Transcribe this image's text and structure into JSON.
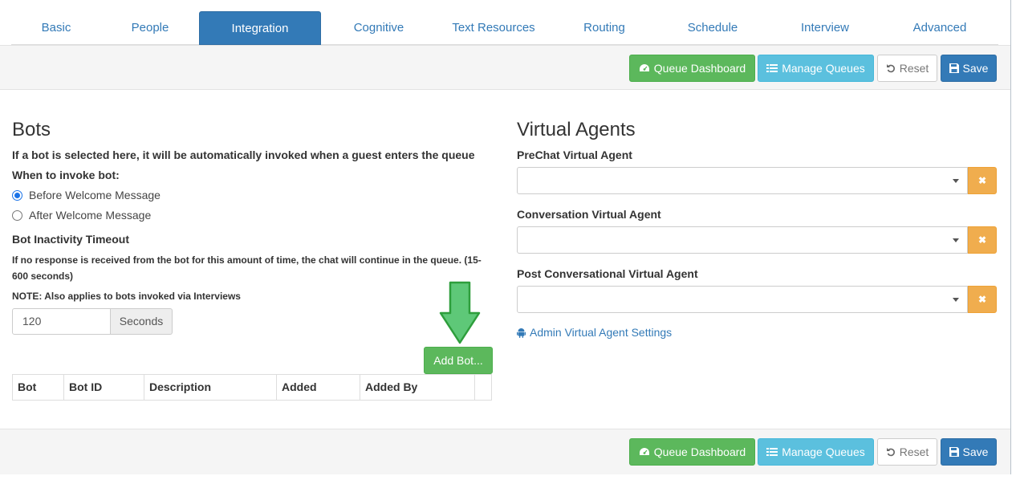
{
  "tabs": [
    {
      "label": "Basic",
      "active": false
    },
    {
      "label": "People",
      "active": false
    },
    {
      "label": "Integration",
      "active": true
    },
    {
      "label": "Cognitive",
      "active": false
    },
    {
      "label": "Text Resources",
      "active": false
    },
    {
      "label": "Routing",
      "active": false
    },
    {
      "label": "Schedule",
      "active": false
    },
    {
      "label": "Interview",
      "active": false
    },
    {
      "label": "Advanced",
      "active": false
    }
  ],
  "toolbar": {
    "queue_dashboard": "Queue Dashboard",
    "manage_queues": "Manage Queues",
    "reset": "Reset",
    "save": "Save"
  },
  "bots": {
    "title": "Bots",
    "description": "If a bot is selected here, it will be automatically invoked when a guest enters the queue",
    "when_label": "When to invoke bot:",
    "options": [
      {
        "label": "Before Welcome Message",
        "checked": true
      },
      {
        "label": "After Welcome Message",
        "checked": false
      }
    ],
    "timeout_label": "Bot Inactivity Timeout",
    "timeout_help_line1": "If no response is received from the bot for this amount of time, the chat will continue in the queue. (15-",
    "timeout_help_line2": "600 seconds)",
    "note": "NOTE: Also applies to bots invoked via Interviews",
    "timeout_value": "120",
    "timeout_unit": "Seconds",
    "add_button": "Add Bot...",
    "columns": [
      "Bot",
      "Bot ID",
      "Description",
      "Added",
      "Added By",
      ""
    ]
  },
  "virtual_agents": {
    "title": "Virtual Agents",
    "fields": [
      {
        "label": "PreChat Virtual Agent",
        "value": ""
      },
      {
        "label": "Conversation Virtual Agent",
        "value": ""
      },
      {
        "label": "Post Conversational Virtual Agent",
        "value": ""
      }
    ],
    "admin_link": "Admin Virtual Agent Settings"
  },
  "colors": {
    "primary": "#337ab7",
    "success": "#5cb85c",
    "info": "#5bc0de",
    "warning": "#f0ad4e"
  },
  "icons": {
    "queue_dashboard": "dashboard-icon",
    "manage_queues": "list-icon",
    "reset": "undo-icon",
    "save": "floppy-disk-icon",
    "clear": "close-icon",
    "admin_link": "android-icon",
    "arrow": "down-arrow-icon"
  }
}
